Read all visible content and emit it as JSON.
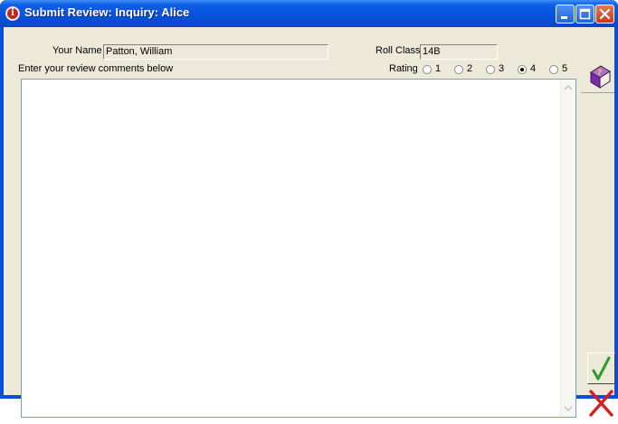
{
  "window": {
    "title": "Submit Review: Inquiry: Alice",
    "colors": {
      "titlebar": "#0753dc",
      "client": "#ece9d8",
      "close_button": "#c8391a",
      "ok_check": "#2f9a2f",
      "cancel_x": "#d42020"
    }
  },
  "form": {
    "name_label": "Your Name",
    "name_value": "Patton, William",
    "roll_class_label": "Roll Class",
    "roll_class_value": "14B",
    "comments_label": "Enter your review comments below",
    "comments_value": "",
    "rating_label": "Rating",
    "rating_options": [
      "1",
      "2",
      "3",
      "4",
      "5"
    ],
    "rating_selected": "4"
  },
  "icons": {
    "help": "help-book-icon",
    "ok": "checkmark-icon",
    "cancel": "red-x-icon",
    "minimize": "minimize-icon",
    "maximize": "maximize-icon",
    "close": "close-icon",
    "app": "info-icon"
  }
}
